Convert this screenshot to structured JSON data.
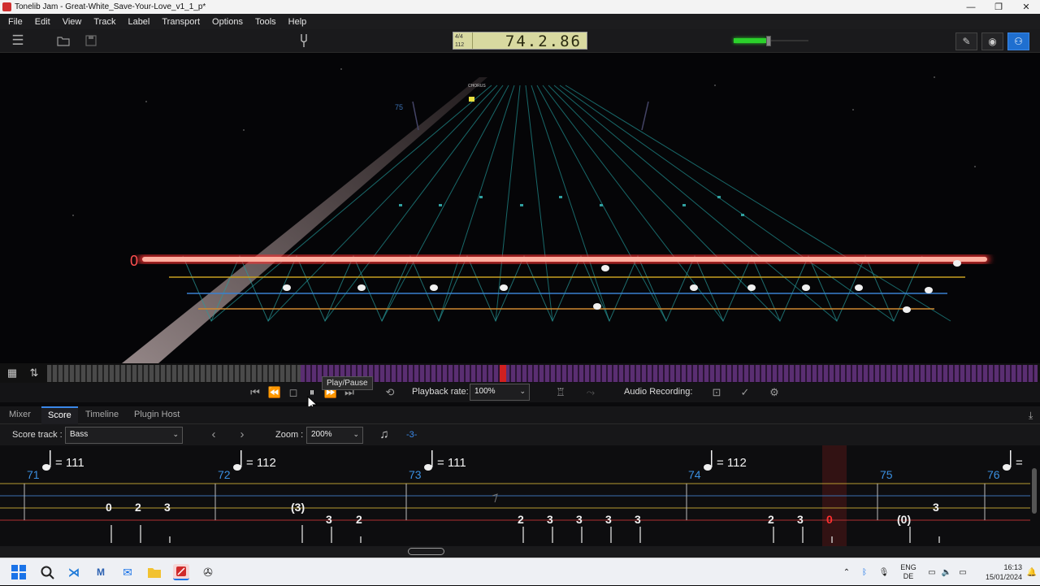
{
  "window": {
    "title": "Tonelib Jam - Great-White_Save-Your-Love_v1_1_p*",
    "buttons": [
      "—",
      "❐",
      "✕"
    ]
  },
  "menu": [
    "File",
    "Edit",
    "View",
    "Track",
    "Label",
    "Transport",
    "Options",
    "Tools",
    "Help"
  ],
  "lcd": {
    "sig_top": "4/4",
    "sig_bottom": "112",
    "position": "74.2.86"
  },
  "volume_level": 0.43,
  "scene": {
    "section_label": "CHORUS",
    "bar_number": "75",
    "string_marker": "0"
  },
  "tooltip": "Play/Pause",
  "transport": {
    "playback_rate_label": "Playback rate:",
    "playback_rate_value": "100%",
    "audio_recording_label": "Audio Recording:"
  },
  "tabs": [
    {
      "label": "Mixer",
      "active": false
    },
    {
      "label": "Score",
      "active": true
    },
    {
      "label": "Timeline",
      "active": false
    },
    {
      "label": "Plugin Host",
      "active": false
    }
  ],
  "score_controls": {
    "score_track_label": "Score track :",
    "score_track_value": "Bass",
    "zoom_label": "Zoom :",
    "zoom_value": "200%",
    "transpose_value": "-3-"
  },
  "score": {
    "measures": [
      {
        "number": "71",
        "tempo": "= 111"
      },
      {
        "number": "72",
        "tempo": "= 112"
      },
      {
        "number": "73",
        "tempo": "= 111"
      },
      {
        "number": "74",
        "tempo": "= 112"
      },
      {
        "number": "75",
        "tempo": ""
      },
      {
        "number": "76",
        "tempo": "="
      }
    ],
    "notes": [
      "0",
      "2",
      "3",
      "(3)",
      "3",
      "2",
      "2",
      "3",
      "3",
      "3",
      "3",
      "2",
      "3",
      "0",
      "(0)",
      "3"
    ]
  },
  "taskbar": {
    "lang_top": "ENG",
    "lang_bottom": "DE",
    "time": "16:13",
    "date": "15/01/2024"
  },
  "colors": {
    "accent": "#1f6fd0",
    "now_line": "#ff3030",
    "lcd_bg": "#d8d9a0",
    "volume": "#2bd12b",
    "measure_number": "#3a8fe0"
  }
}
